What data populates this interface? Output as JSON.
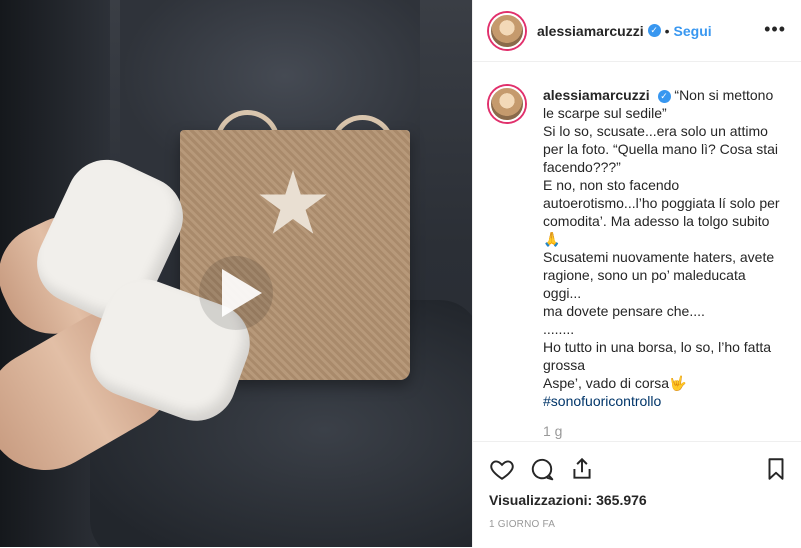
{
  "post": {
    "media_type": "video",
    "play_icon": "play-icon"
  },
  "header": {
    "username": "alessiamarcuzzi",
    "verified_icon": "verified-badge-icon",
    "separator": "•",
    "follow_label": "Segui",
    "more_icon": "more-options-icon"
  },
  "caption": {
    "username": "alessiamarcuzzi",
    "lines": [
      "“Non si mettono le scarpe sul sedile”",
      "Si lo so, scusate...era solo un attimo per la foto. “Quella mano lì? Cosa stai facendo???”",
      "E no, non sto facendo autoerotismo...l’ho poggiata lí solo per comodita’. Ma adesso la tolgo subito 🙏",
      "Scusatemi nuovamente haters, avete ragione, sono un po’ maleducata oggi...",
      "ma dovete pensare che....",
      "........",
      "Ho tutto in una borsa, lo so, l’ho fatta grossa",
      "Aspe’, vado di corsa🤟"
    ],
    "hashtag": "#sonofuoricontrollo",
    "time_ago": "1 g"
  },
  "actions": {
    "like_icon": "heart-icon",
    "comment_icon": "comment-icon",
    "share_icon": "share-icon",
    "save_icon": "bookmark-icon",
    "views_label": "Visualizzazioni:",
    "views_count": "365.976",
    "date": "1 GIORNO FA"
  },
  "colors": {
    "link": "#3897f0",
    "hashtag": "#003569",
    "muted": "#999999",
    "border": "#efefef"
  }
}
